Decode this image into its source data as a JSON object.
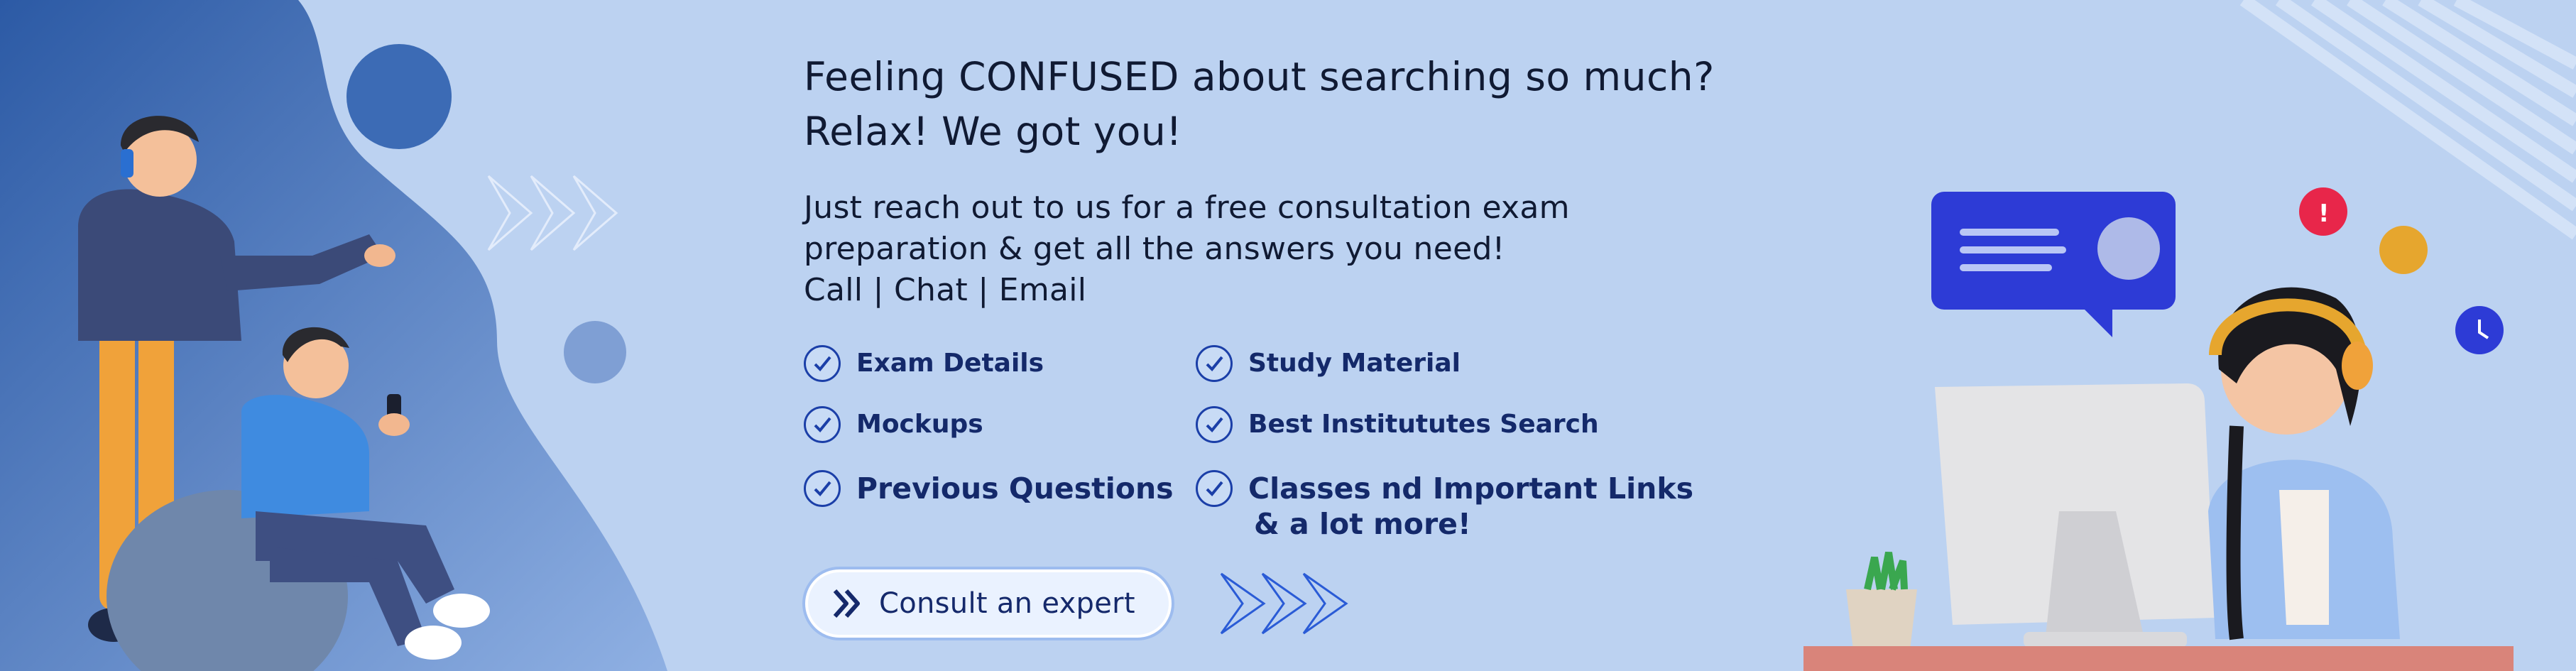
{
  "banner": {
    "headline_line1": "Feeling CONFUSED about searching so much?",
    "headline_line2": "Relax! We got you!",
    "intro_line1": "Just reach out to us for a free consultation exam",
    "intro_line2": "preparation & get all the answers you need!",
    "contact_line": "Call | Chat | Email"
  },
  "features": [
    {
      "label": "Exam Details"
    },
    {
      "label": "Study Material"
    },
    {
      "label": "Mockups"
    },
    {
      "label": "Best Institututes Search"
    },
    {
      "label": "Previous Questions"
    },
    {
      "label": "Classes nd Important Links",
      "sub": "& a lot more!"
    }
  ],
  "cta": {
    "label": "Consult an expert"
  },
  "icons": {
    "check": "check-circle-icon",
    "cta": "double-chevron-right-icon",
    "chat": "chat-bubble-icon",
    "arrows": "triple-chevron-icon"
  },
  "colors": {
    "background": "#bcd2f1",
    "accent_dark": "#14296a",
    "blob_dark": "#2f5ea8",
    "chat_bubble": "#2d3bd6"
  }
}
